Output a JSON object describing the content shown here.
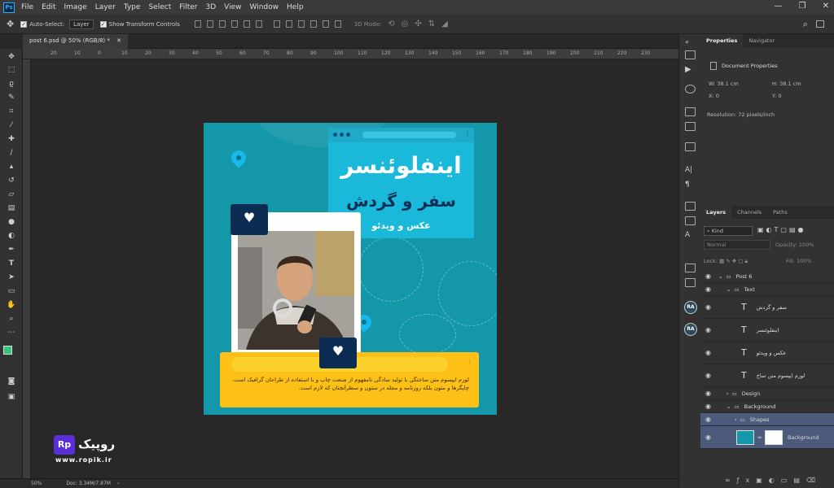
{
  "app": {
    "menus": [
      "File",
      "Edit",
      "Image",
      "Layer",
      "Type",
      "Select",
      "Filter",
      "3D",
      "View",
      "Window",
      "Help"
    ],
    "window_controls": [
      "—",
      "❐",
      "✕"
    ]
  },
  "options": {
    "auto_select_label": "Auto-Select:",
    "layer_dropdown": "Layer",
    "transform_label": "Show Transform Controls",
    "mode_3d": "3D Mode:"
  },
  "document": {
    "tab_title": "post 6.psd @ 50% (RGB/8) *",
    "zoom": "50%",
    "doc_size": "Doc: 3.34M/7.87M",
    "ruler_ticks": [
      "20",
      "10",
      "0",
      "10",
      "20",
      "30",
      "40",
      "50",
      "60",
      "70",
      "80",
      "90",
      "100",
      "110",
      "120",
      "130",
      "140",
      "150",
      "160",
      "170",
      "180",
      "190",
      "200",
      "210",
      "220",
      "230"
    ]
  },
  "properties": {
    "tabs": [
      "Properties",
      "Navigator"
    ],
    "section": "Document Properties",
    "w_label": "W:",
    "w": "38.1 cm",
    "h_label": "H:",
    "h": "38.1 cm",
    "x_label": "X:",
    "x": "0",
    "y_label": "Y:",
    "y": "0",
    "resolution": "Resolution: 72 pixels/inch"
  },
  "layers": {
    "tabs": [
      "Layers",
      "Channels",
      "Paths"
    ],
    "kind": "Kind",
    "blend": "Normal",
    "opacity_label": "Opacity:",
    "opacity": "100%",
    "lock_label": "Lock:",
    "fill_label": "Fill:",
    "fill": "100%",
    "items": [
      "Post 6",
      "Text",
      "سفر و گردش",
      "اینفلوئنسر",
      "عکس و ویدئو",
      "لورم ایپسوم متن ساخ",
      "Design",
      "Background",
      "Shapes",
      "Background"
    ]
  },
  "design": {
    "title1": "اینفلوئنسر",
    "title2": "سفر و گردش",
    "title3": "عکس و ویدئو",
    "paragraph": "لورم ایپسوم متن ساختگی با تولید سادگی نامفهوم از صنعت چاپ و با استفاده از طراحان گرافیک است. چاپگرها و متون بلکه روزنامه و مجله در ستون و سطرآنچنان که لازم است.",
    "colors": {
      "bg": "#1497a8",
      "accent": "#1ab8d9",
      "navy": "#0d2c54",
      "yellow": "#fcc016"
    }
  },
  "logo": {
    "badge": "Rp",
    "name": "روپیک",
    "url": "www.ropik.ir"
  }
}
